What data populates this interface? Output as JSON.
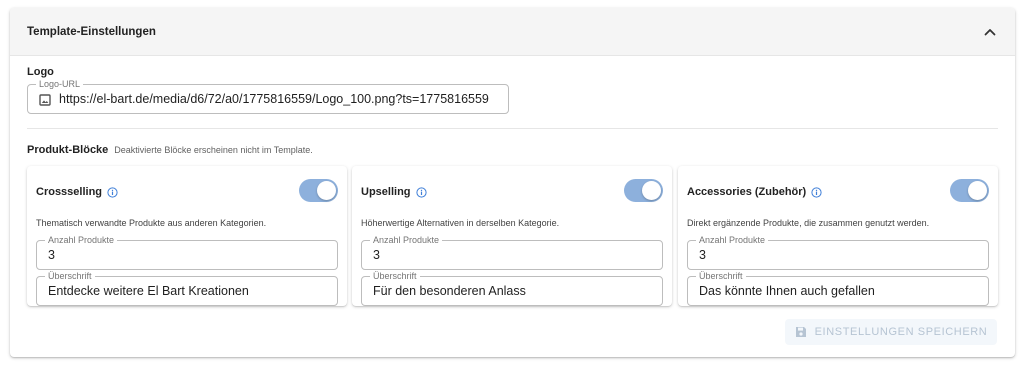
{
  "header": {
    "title": "Template-Einstellungen"
  },
  "logo": {
    "section_label": "Logo",
    "field_label": "Logo-URL",
    "value": "https://el-bart.de/media/d6/72/a0/1775816559/Logo_100.png?ts=1775816559"
  },
  "blocks": {
    "section_label": "Produkt-Blöcke",
    "note": "Deaktivierte Blöcke erscheinen nicht im Template.",
    "cards": [
      {
        "title": "Crossselling",
        "enabled": true,
        "description": "Thematisch verwandte Produkte aus anderen Kategorien.",
        "count_label": "Anzahl Produkte",
        "count_value": "3",
        "heading_label": "Überschrift",
        "heading_value": "Entdecke weitere El Bart Kreationen"
      },
      {
        "title": "Upselling",
        "enabled": true,
        "description": "Höherwertige Alternativen in derselben Kategorie.",
        "count_label": "Anzahl Produkte",
        "count_value": "3",
        "heading_label": "Überschrift",
        "heading_value": "Für den besonderen Anlass"
      },
      {
        "title": "Accessories (Zubehör)",
        "enabled": true,
        "description": "Direkt ergänzende Produkte, die zusammen genutzt werden.",
        "count_label": "Anzahl Produkte",
        "count_value": "3",
        "heading_label": "Überschrift",
        "heading_value": "Das könnte Ihnen auch gefallen"
      }
    ]
  },
  "actions": {
    "save_label": "EINSTELLUNGEN SPEICHERN",
    "save_disabled": true
  },
  "colors": {
    "toggle_on": "#8db0dc",
    "info_icon": "#3f7fd8",
    "save_disabled_text": "#b6c4d3"
  },
  "icons": {
    "collapse": "chevron-up-icon",
    "logo_field": "image-icon",
    "info": "info-icon",
    "save": "floppy-disk-icon"
  }
}
